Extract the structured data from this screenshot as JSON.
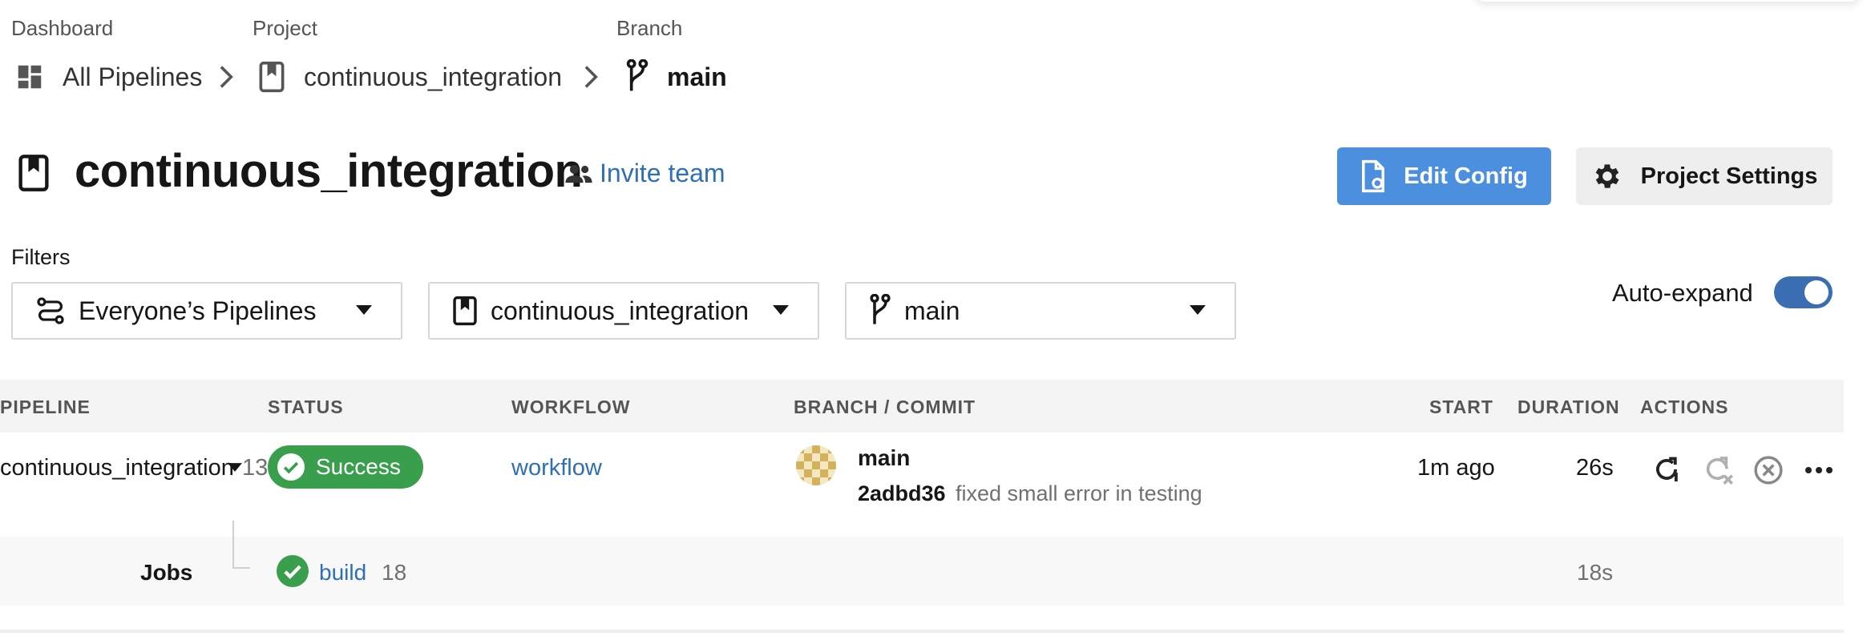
{
  "breadcrumb": {
    "dashboard": {
      "label": "Dashboard",
      "value": "All Pipelines"
    },
    "project": {
      "label": "Project",
      "value": "continuous_integration"
    },
    "branch": {
      "label": "Branch",
      "value": "main"
    }
  },
  "header": {
    "title": "continuous_integration",
    "invite": "Invite team",
    "edit_config": "Edit Config",
    "project_settings": "Project Settings"
  },
  "filters": {
    "label": "Filters",
    "pipelines": "Everyone’s Pipelines",
    "project": "continuous_integration",
    "branch": "main",
    "auto_expand_label": "Auto-expand",
    "auto_expand": true
  },
  "table": {
    "headers": {
      "pipeline": "PIPELINE",
      "status": "STATUS",
      "workflow": "WORKFLOW",
      "branch_commit": "BRANCH / COMMIT",
      "start": "START",
      "duration": "DURATION",
      "actions": "ACTIONS"
    },
    "row": {
      "pipeline": "continuous_integration",
      "number": "13",
      "status": "Success",
      "workflow": "workflow",
      "branch": "main",
      "commit_hash": "2adbd36",
      "commit_msg": "fixed small error in testing",
      "start": "1m ago",
      "duration": "26s"
    },
    "jobs": {
      "label": "Jobs",
      "job_name": "build",
      "job_number": "18",
      "duration": "18s"
    }
  },
  "colors": {
    "primary": "#4d8fdf",
    "link": "#2f6fb6",
    "success": "#3a9f4c",
    "toggle": "#3a6db1"
  }
}
